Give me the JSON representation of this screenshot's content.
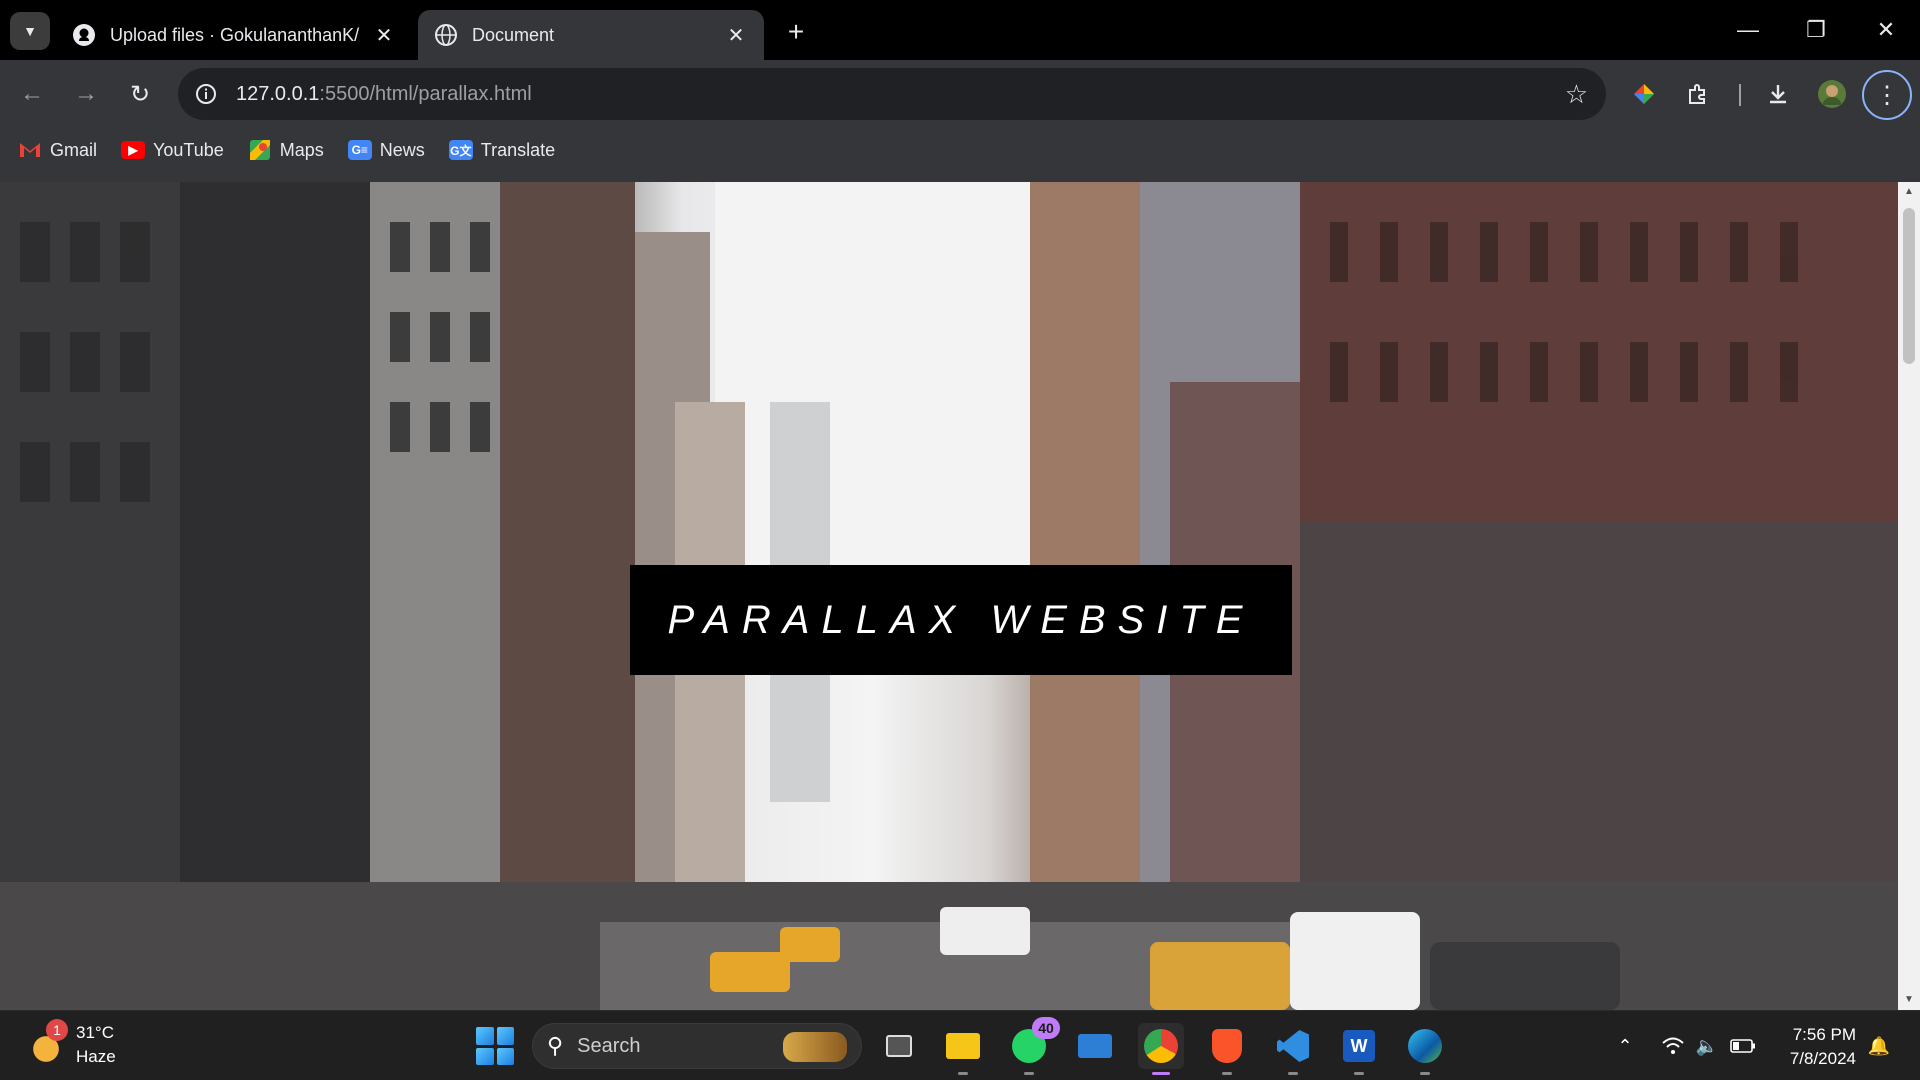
{
  "browser": {
    "tabs": [
      {
        "title": "Upload files · GokulananthanK/",
        "active": false
      },
      {
        "title": "Document",
        "active": true
      }
    ],
    "url_host": "127.0.0.1",
    "url_rest": ":5500/html/parallax.html",
    "bookmarks": [
      {
        "label": "Gmail",
        "icon": "gmail-icon",
        "color": "#ea4335"
      },
      {
        "label": "YouTube",
        "icon": "youtube-icon",
        "color": "#ff0000"
      },
      {
        "label": "Maps",
        "icon": "maps-icon",
        "color": "#34a853"
      },
      {
        "label": "News",
        "icon": "news-icon",
        "color": "#4285f4"
      },
      {
        "label": "Translate",
        "icon": "translate-icon",
        "color": "#4285f4"
      }
    ]
  },
  "page": {
    "hero_title": "PARALLAX WEBSITE"
  },
  "taskbar": {
    "weather_temp": "31°C",
    "weather_desc": "Haze",
    "weather_badge": "1",
    "search_label": "Search",
    "whatsapp_badge": "40",
    "time": "7:56 PM",
    "date": "7/8/2024"
  }
}
